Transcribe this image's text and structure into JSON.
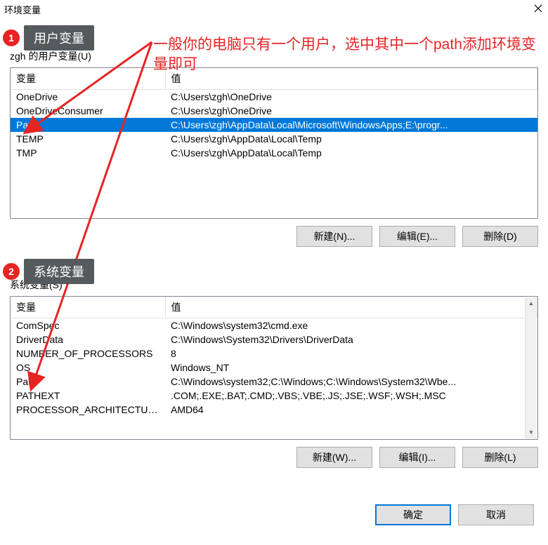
{
  "window": {
    "title": "环境变量"
  },
  "annotation": {
    "text": "一般你的电脑只有一个用户，选中其中一个path添加环境变量即可",
    "badge1_num": "1",
    "badge1_label": "用户变量",
    "badge2_num": "2",
    "badge2_label": "系统变量"
  },
  "user_section": {
    "label": "zgh 的用户变量(U)",
    "columns": {
      "var": "变量",
      "val": "值"
    },
    "rows": [
      {
        "var": "OneDrive",
        "val": "C:\\Users\\zgh\\OneDrive",
        "selected": false
      },
      {
        "var": "OneDriveConsumer",
        "val": "C:\\Users\\zgh\\OneDrive",
        "selected": false
      },
      {
        "var": "Path",
        "val": "C:\\Users\\zgh\\AppData\\Local\\Microsoft\\WindowsApps;E:\\progr...",
        "selected": true
      },
      {
        "var": "TEMP",
        "val": "C:\\Users\\zgh\\AppData\\Local\\Temp",
        "selected": false
      },
      {
        "var": "TMP",
        "val": "C:\\Users\\zgh\\AppData\\Local\\Temp",
        "selected": false
      }
    ],
    "buttons": {
      "new": "新建(N)...",
      "edit": "编辑(E)...",
      "delete": "删除(D)"
    }
  },
  "system_section": {
    "label": "系统变量(S)",
    "columns": {
      "var": "变量",
      "val": "值"
    },
    "rows": [
      {
        "var": "ComSpec",
        "val": "C:\\Windows\\system32\\cmd.exe"
      },
      {
        "var": "DriverData",
        "val": "C:\\Windows\\System32\\Drivers\\DriverData"
      },
      {
        "var": "NUMBER_OF_PROCESSORS",
        "val": "8"
      },
      {
        "var": "OS",
        "val": "Windows_NT"
      },
      {
        "var": "Path",
        "val": "C:\\Windows\\system32;C:\\Windows;C:\\Windows\\System32\\Wbe..."
      },
      {
        "var": "PATHEXT",
        "val": ".COM;.EXE;.BAT;.CMD;.VBS;.VBE;.JS;.JSE;.WSF;.WSH;.MSC"
      },
      {
        "var": "PROCESSOR_ARCHITECTURE",
        "val": "AMD64"
      }
    ],
    "buttons": {
      "new": "新建(W)...",
      "edit": "编辑(I)...",
      "delete": "删除(L)"
    }
  },
  "footer": {
    "ok": "确定",
    "cancel": "取消"
  }
}
